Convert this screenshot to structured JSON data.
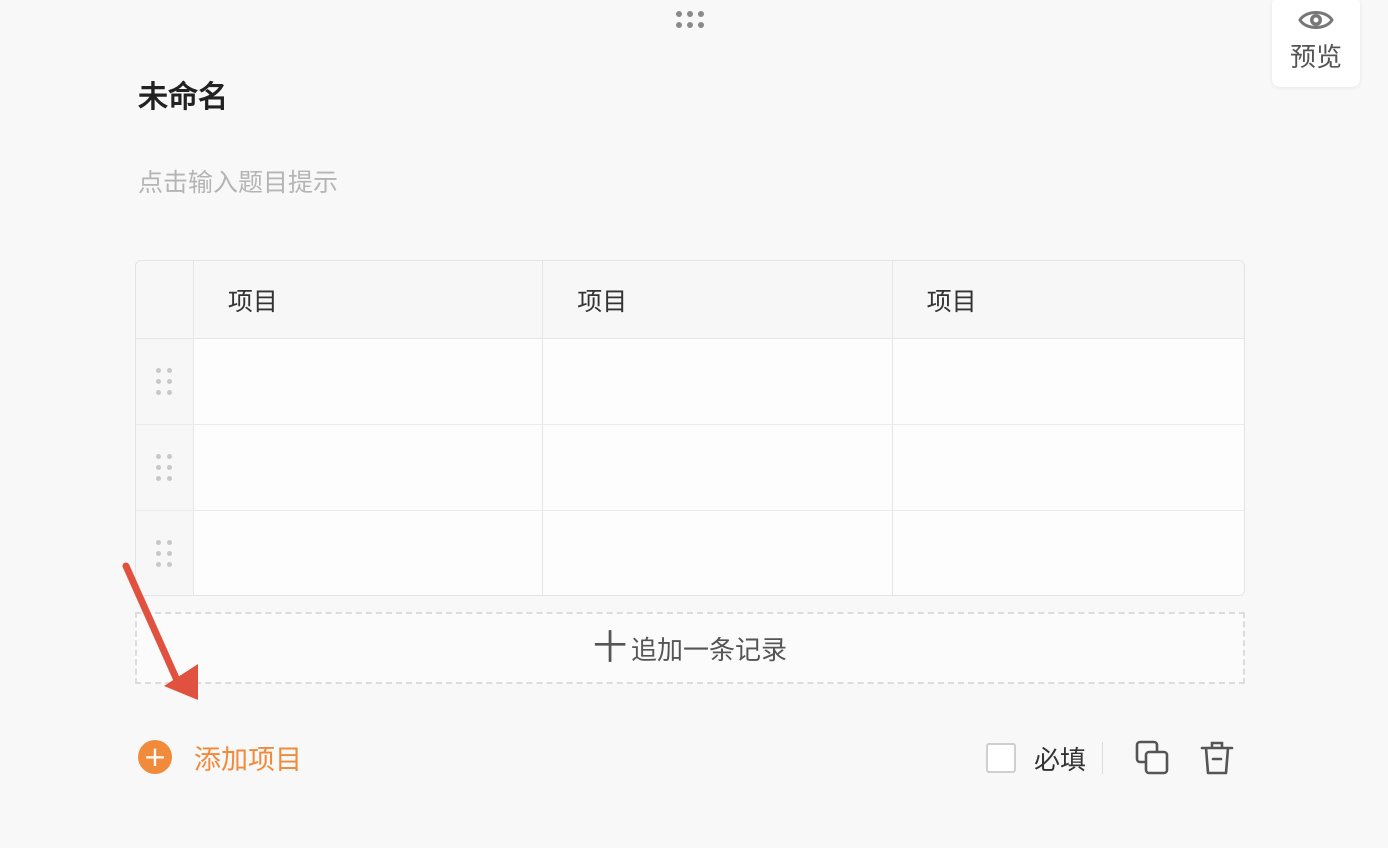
{
  "preview": {
    "label": "预览",
    "icon": "eye-icon"
  },
  "question": {
    "title": "未命名",
    "hint": "点击输入题目提示"
  },
  "table": {
    "columns": [
      "项目",
      "项目",
      "项目"
    ],
    "rows": [
      [
        "",
        "",
        ""
      ],
      [
        "",
        "",
        ""
      ],
      [
        "",
        "",
        ""
      ]
    ]
  },
  "add_record": {
    "plus": "十",
    "label": "追加一条记录"
  },
  "add_item": {
    "label": "添加项目",
    "icon": "plus-circle-icon"
  },
  "required": {
    "label": "必填",
    "checked": false
  },
  "colors": {
    "accent": "#f28a3c",
    "arrow": "#e0523f"
  }
}
